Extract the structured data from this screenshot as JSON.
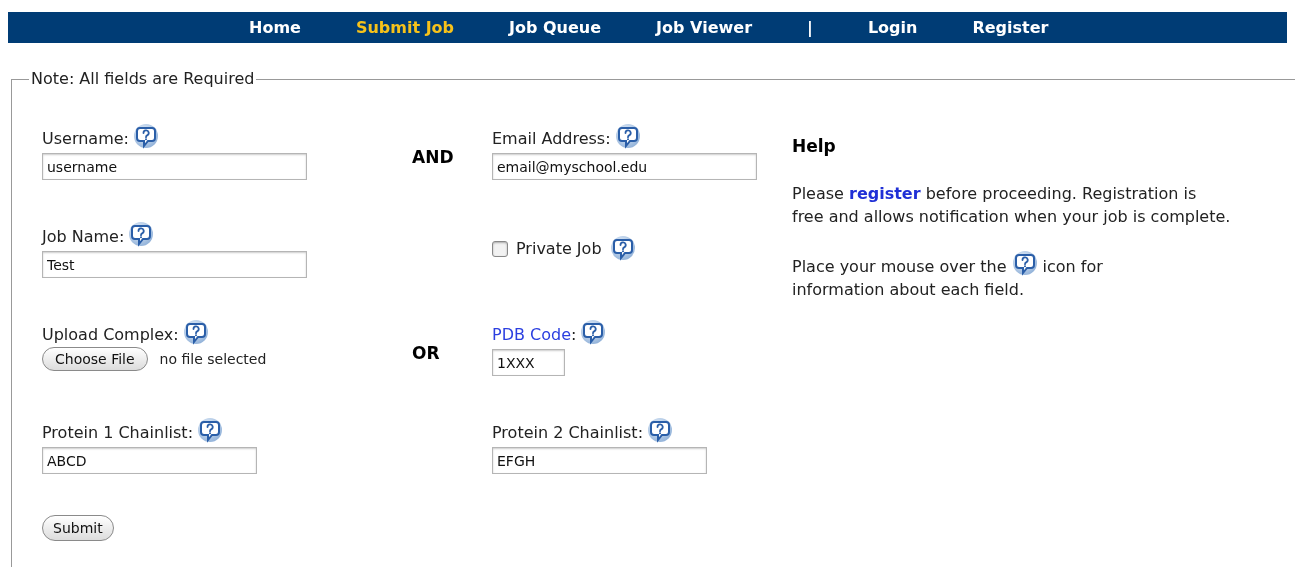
{
  "nav": [
    {
      "kind": "link",
      "label": "Home",
      "selected": false
    },
    {
      "kind": "link",
      "label": "Submit Job",
      "selected": true
    },
    {
      "kind": "link",
      "label": "Job Queue",
      "selected": false
    },
    {
      "kind": "link",
      "label": "Job Viewer",
      "selected": false
    },
    {
      "kind": "separator",
      "label": "|"
    },
    {
      "kind": "link",
      "label": "Login",
      "selected": false
    },
    {
      "kind": "link",
      "label": "Register",
      "selected": false
    }
  ],
  "form": {
    "legend": "Note: All fields are Required",
    "rows": [
      {
        "connector": "AND",
        "left": {
          "kind": "text",
          "label": "Username:",
          "value": "username"
        },
        "right": {
          "kind": "text",
          "label": "Email Address:",
          "value": "email@myschool.edu"
        }
      },
      {
        "left": {
          "kind": "text",
          "label": "Job Name:",
          "value": "Test"
        },
        "right": {
          "kind": "checkbox",
          "label": "Private Job",
          "checked": false
        }
      },
      {
        "connector": "OR",
        "left": {
          "kind": "file",
          "label": "Upload Complex:",
          "button": "Choose File",
          "status": "no file selected"
        },
        "right": {
          "kind": "link-text",
          "label": "PDB Code",
          "suffix": ":",
          "value": "1XXX"
        }
      },
      {
        "left": {
          "kind": "text",
          "label": "Protein 1 Chainlist:",
          "value": "ABCD"
        },
        "right": {
          "kind": "text",
          "label": "Protein 2 Chainlist:",
          "value": "EFGH"
        }
      }
    ],
    "submit": "Submit"
  },
  "help": {
    "title": "Help",
    "before": "Please",
    "link": "register",
    "after": "before proceeding. Registration is free and allows notification when your job is complete.",
    "hint_before": "Place your mouse over the",
    "hint_middle": "icon for",
    "hint_after": "information about each field."
  }
}
